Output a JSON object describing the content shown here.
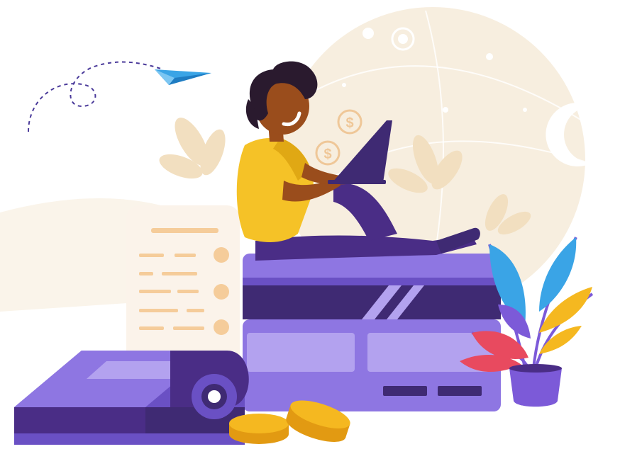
{
  "colors": {
    "background": "#ffffff",
    "backdrop_circle": "#f7eedf",
    "backdrop_leaf": "#f2dfc0",
    "shirt": "#f5c227",
    "skin": "#9a4d1c",
    "hair": "#2a1a2e",
    "pants": "#4a2d86",
    "card_main": "#8e76e2",
    "card_dark": "#3f2a73",
    "card_light": "#b3a2ef",
    "receipt": "#fbf3ea",
    "receipt_line": "#f5cc9a",
    "coin": "#f5b820",
    "coin_edge": "#e29a12",
    "paper_plane": "#3aa4e6",
    "plant_pot": "#7c5ad8",
    "plant_blue": "#3aa4e6",
    "plant_red": "#e84a5f",
    "plant_yellow": "#f5b820"
  }
}
